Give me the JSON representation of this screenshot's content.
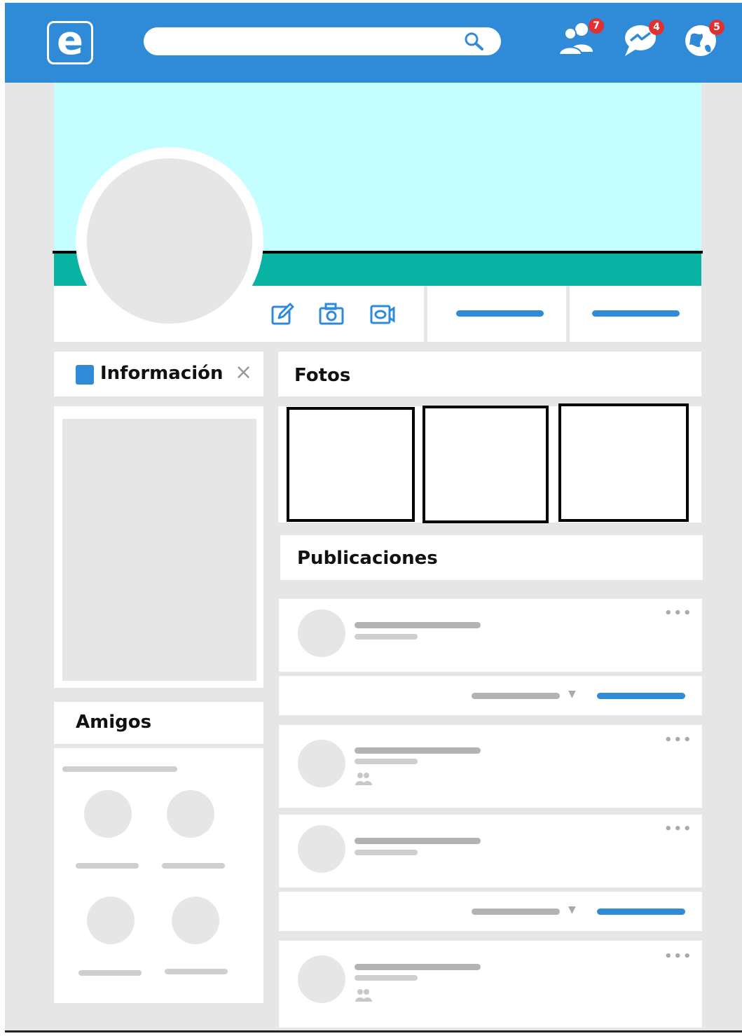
{
  "header": {
    "logo_letter": "e",
    "badges": {
      "friends": "7",
      "messages": "4",
      "notifications": "5"
    }
  },
  "sidebar": {
    "info_title": "Información",
    "close_symbol": "×",
    "friends_title": "Amigos"
  },
  "main": {
    "photos_title": "Fotos",
    "posts_title": "Publicaciones",
    "more_symbol": "•••",
    "dropdown_symbol": "▼"
  },
  "colors": {
    "brand": "#2f8ad8",
    "cover": "#c4fefe",
    "cover_band": "#09b3a4",
    "badge": "#e0302f"
  },
  "icons": [
    "search-icon",
    "friends-icon",
    "messenger-icon",
    "globe-icon",
    "edit-icon",
    "camera-icon",
    "video-icon",
    "group-icon"
  ]
}
